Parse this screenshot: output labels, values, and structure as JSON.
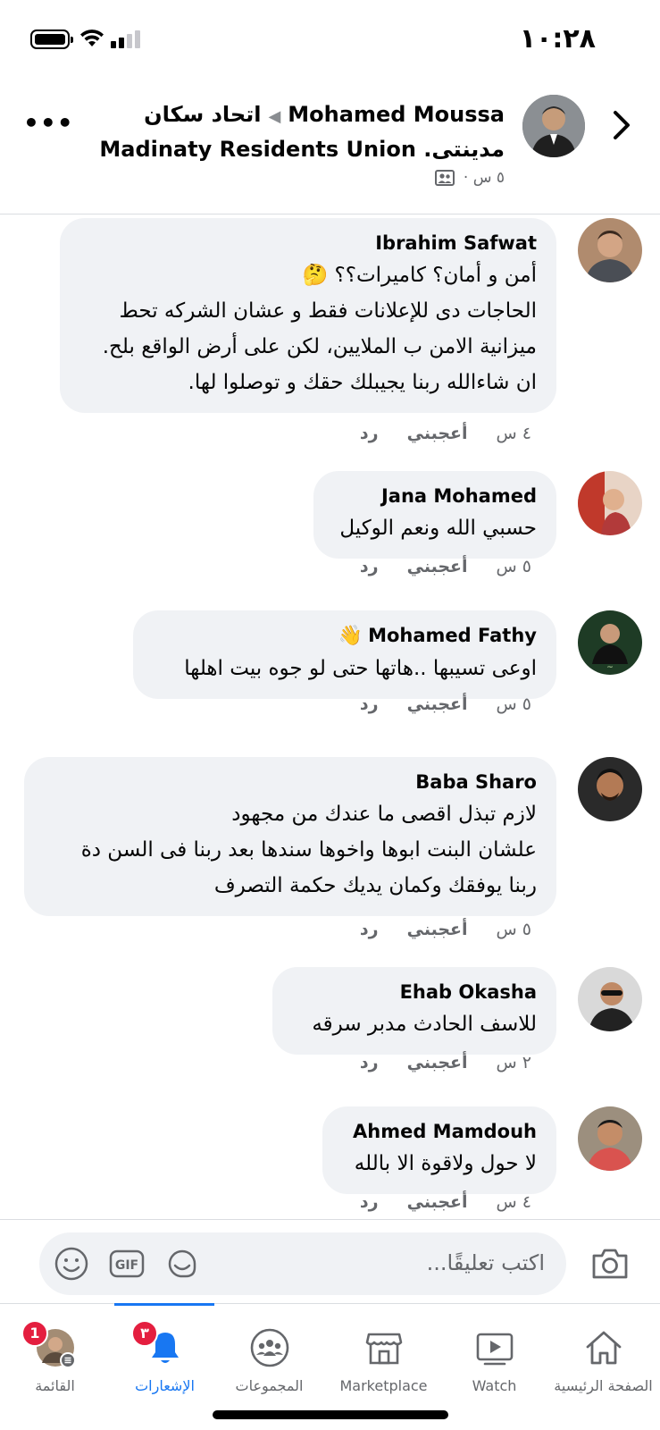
{
  "status_bar": {
    "time": "١٠:٢٨"
  },
  "post_header": {
    "author": "Mohamed Moussa",
    "group_part1": "اتحاد سكان",
    "group_part2": "مدينتى. Madinaty Residents Union",
    "meta": "٥ س ·"
  },
  "comments": [
    {
      "name": "Ibrahim Safwat",
      "text": "أمن و أمان؟ كاميرات؟؟ 🤔\nالحاجات دى للإعلانات فقط و عشان الشركه تحط\nميزانية الامن ب الملايين، لكن على أرض الواقع بلح.\nان شاءالله ربنا يجيبلك حقك و توصلوا لها.",
      "time": "٤ س",
      "like": "أعجبني",
      "reply": "رد"
    },
    {
      "name": "Jana Mohamed",
      "text": "حسبي الله ونعم الوكيل",
      "time": "٥ س",
      "like": "أعجبني",
      "reply": "رد"
    },
    {
      "name": "Mohamed Fathy",
      "text": "اوعى تسيبها ..هاتها حتى لو جوه بيت اهلها",
      "time": "٥ س",
      "like": "أعجبني",
      "reply": "رد",
      "badge_emoji": "👋"
    },
    {
      "name": "Baba Sharo",
      "text": "لازم تبذل اقصى ما عندك من مجهود\nعلشان البنت ابوها واخوها سندها بعد ربنا فى السن دة\nربنا يوفقك وكمان يديك حكمة التصرف",
      "time": "٥ س",
      "like": "أعجبني",
      "reply": "رد"
    },
    {
      "name": "Ehab Okasha",
      "text": "للاسف الحادث مدبر  سرقه",
      "time": "٢ س",
      "like": "أعجبني",
      "reply": "رد"
    },
    {
      "name": "Ahmed Mamdouh",
      "text": "لا حول ولاقوة الا بالله",
      "time": "٤ س",
      "like": "أعجبني",
      "reply": "رد"
    }
  ],
  "composer": {
    "placeholder": "اكتب تعليقًا...",
    "icons": [
      "camera-icon",
      "sticker-icon",
      "gif-icon",
      "emoji-icon"
    ]
  },
  "tab_bar": {
    "tabs": [
      {
        "label": "الصفحة الرئيسية",
        "icon": "home-icon"
      },
      {
        "label": "Watch",
        "icon": "watch-icon"
      },
      {
        "label": "Marketplace",
        "icon": "marketplace-icon"
      },
      {
        "label": "المجموعات",
        "icon": "groups-icon"
      },
      {
        "label": "الإشعارات",
        "icon": "bell-icon",
        "badge": "٣",
        "active": true
      },
      {
        "label": "القائمة",
        "icon": "menu-avatar-icon",
        "badge": "1"
      }
    ]
  },
  "colors": {
    "accent": "#1877f2",
    "bubble": "#f0f2f5",
    "secondary_text": "#65676b",
    "badge": "#e41e3f"
  }
}
